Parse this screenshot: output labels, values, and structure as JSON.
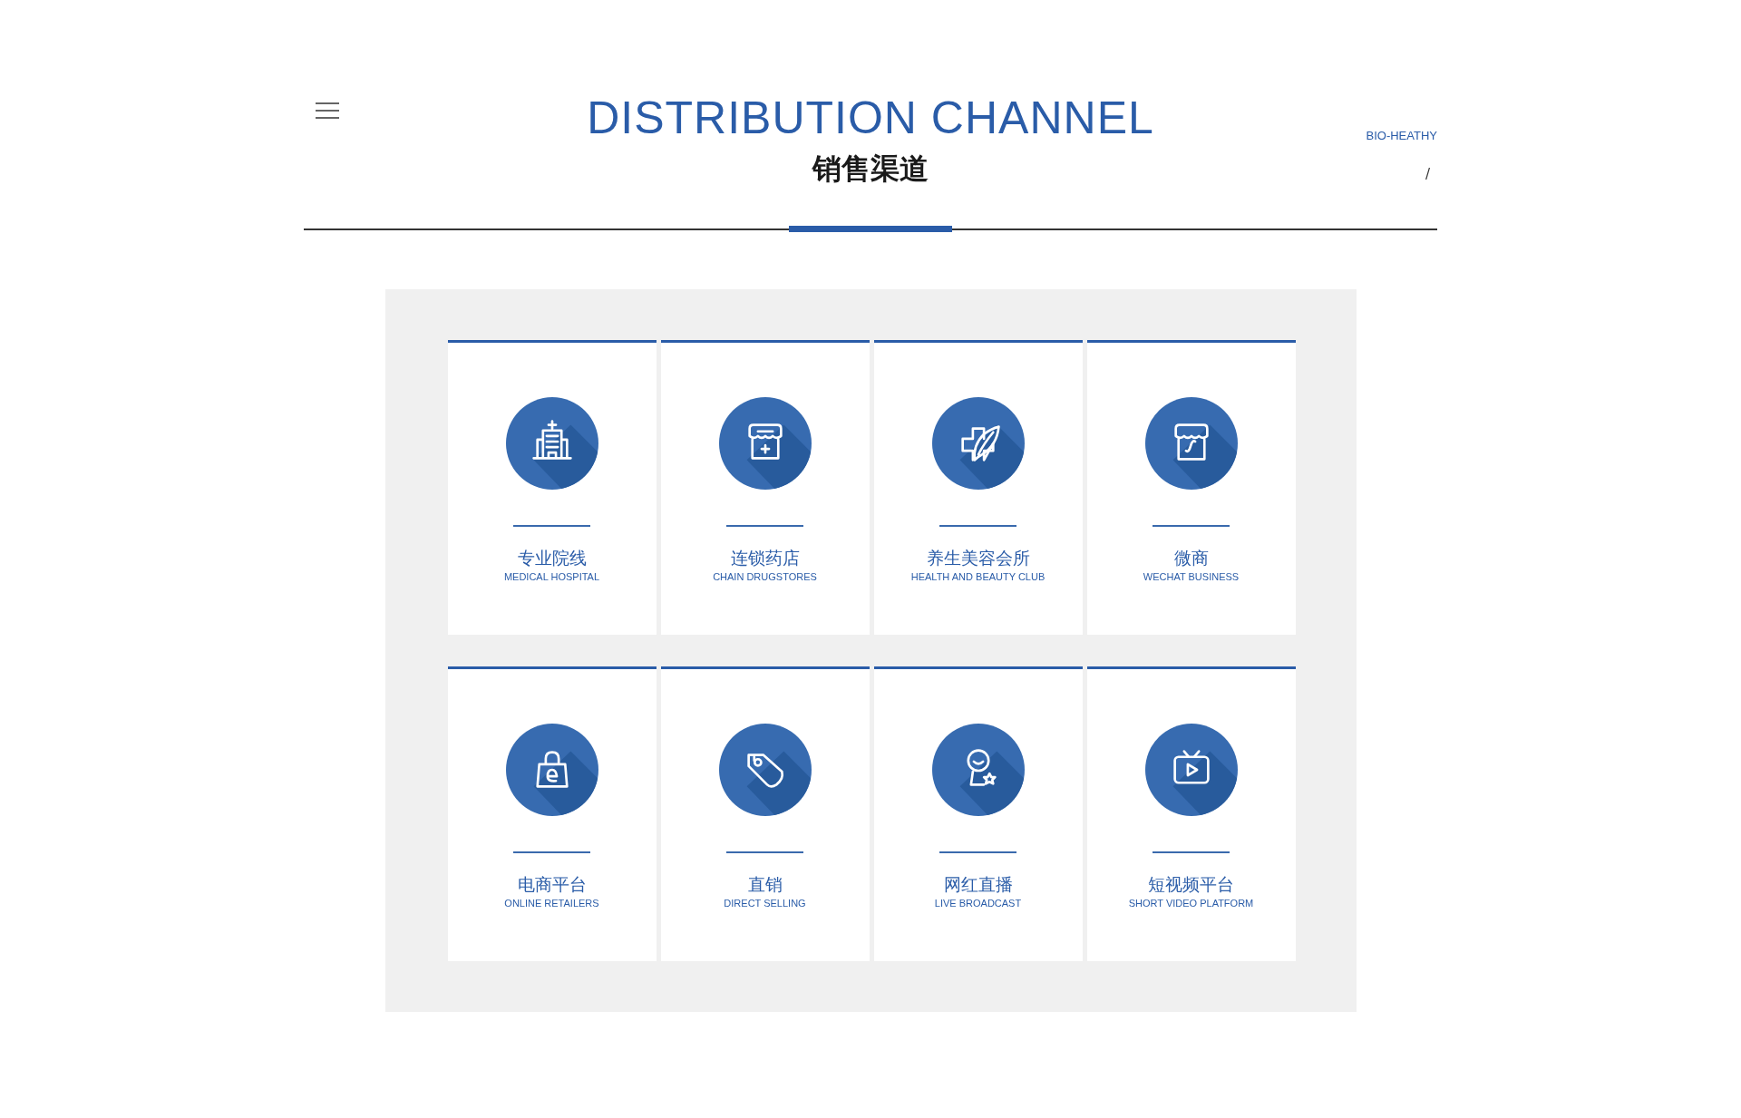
{
  "header": {
    "title": "DISTRIBUTION CHANNEL",
    "subtitle": "销售渠道",
    "brand": "BIO-HEATHY",
    "separator": "/"
  },
  "channels": [
    {
      "kind": "hospital",
      "name": "专业院线",
      "english": "MEDICAL HOSPITAL"
    },
    {
      "kind": "pharmacy",
      "name": "连锁药店",
      "english": "CHAIN DRUGSTORES"
    },
    {
      "kind": "wellness",
      "name": "养生美容会所",
      "english": "HEALTH AND BEAUTY CLUB"
    },
    {
      "kind": "shop",
      "name": "微商",
      "english": "WECHAT BUSINESS"
    },
    {
      "kind": "bag",
      "name": "电商平台",
      "english": "ONLINE RETAILERS"
    },
    {
      "kind": "tag",
      "name": "直销",
      "english": "DIRECT SELLING"
    },
    {
      "kind": "streamer",
      "name": "网红直播",
      "english": "LIVE BROADCAST"
    },
    {
      "kind": "tv",
      "name": "短视频平台",
      "english": "SHORT VIDEO PLATFORM"
    }
  ]
}
